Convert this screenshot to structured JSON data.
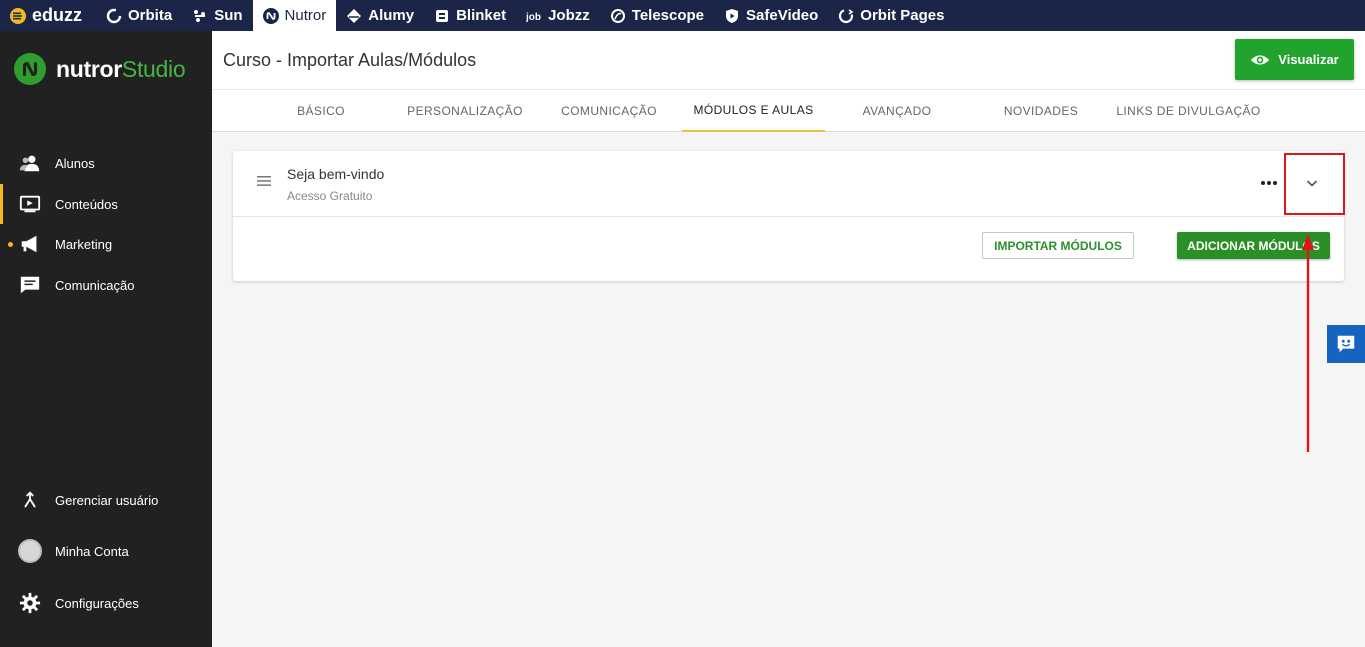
{
  "topbar": {
    "brand": "eduzz",
    "items": [
      {
        "label": "Orbita",
        "icon": "orbita-icon"
      },
      {
        "label": "Sun",
        "icon": "sun-icon"
      },
      {
        "label": "Nutror",
        "icon": "nutror-icon",
        "active": true
      },
      {
        "label": "Alumy",
        "icon": "alumy-icon"
      },
      {
        "label": "Blinket",
        "icon": "blinket-icon"
      },
      {
        "label": "Jobzz",
        "icon": "jobzz-icon"
      },
      {
        "label": "Telescope",
        "icon": "telescope-icon"
      },
      {
        "label": "SafeVideo",
        "icon": "safevideo-icon"
      },
      {
        "label": "Orbit Pages",
        "icon": "orbit-pages-icon"
      }
    ]
  },
  "sidebar": {
    "logo_main": "nutror",
    "logo_sub": "Studio",
    "items": [
      {
        "label": "Alunos",
        "icon": "students-icon"
      },
      {
        "label": "Conteúdos",
        "icon": "content-icon"
      },
      {
        "label": "Marketing",
        "icon": "megaphone-icon"
      },
      {
        "label": "Comunicação",
        "icon": "chat-icon"
      }
    ],
    "bottom_items": [
      {
        "label": "Gerenciar usuário",
        "icon": "user-switch-icon"
      },
      {
        "label": "Minha Conta",
        "icon": "avatar"
      },
      {
        "label": "Configurações",
        "icon": "gear-icon"
      }
    ]
  },
  "header": {
    "title": "Curso - Importar Aulas/Módulos",
    "preview_label": "Visualizar"
  },
  "tabs": [
    {
      "label": "BÁSICO"
    },
    {
      "label": "PERSONALIZAÇÃO"
    },
    {
      "label": "COMUNICAÇÃO"
    },
    {
      "label": "MÓDULOS E AULAS",
      "active": true
    },
    {
      "label": "AVANÇADO"
    },
    {
      "label": "NOVIDADES"
    },
    {
      "label": "LINKS DE DIVULGAÇÃO"
    }
  ],
  "module": {
    "title": "Seja bem-vindo",
    "subtitle": "Acesso Gratuito",
    "import_label": "IMPORTAR MÓDULOS",
    "add_label": "ADICIONAR MÓDULOS"
  },
  "colors": {
    "topbar": "#1b2547",
    "sidebar": "#212121",
    "accent_green": "#22a32e",
    "active_tab": "#e8c43a",
    "annotation": "#e0141a"
  }
}
